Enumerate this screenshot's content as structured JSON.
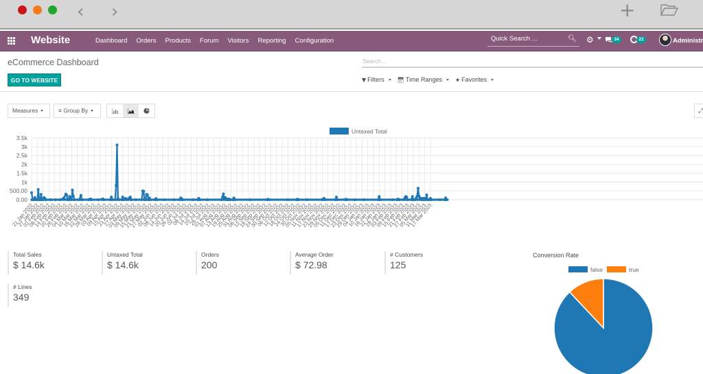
{
  "browser": {
    "back_glyph": "‹",
    "forward_glyph": "›",
    "new_tab_glyph": "+",
    "icons": [
      "close-dot",
      "minimize-dot",
      "maximize-dot",
      "back-arrow-icon",
      "forward-arrow-icon",
      "plus-icon",
      "folder-icon"
    ]
  },
  "navbar": {
    "app_name": "Website",
    "menu": [
      "Dashboard",
      "Orders",
      "Products",
      "Forum",
      "Visitors",
      "Reporting",
      "Configuration"
    ],
    "quick_search_placeholder": "Quick Search ...",
    "messages_count": "34",
    "activities_count": "22",
    "user_name": "Administrator",
    "colors": {
      "bar": "#875a7b",
      "badge": "#00a09d"
    }
  },
  "control_panel": {
    "title": "eCommerce Dashboard",
    "go_button": "GO TO WEBSITE",
    "search_placeholder": "Search...",
    "filters": [
      "Filters",
      "Time Ranges",
      "Favorites"
    ]
  },
  "toolbar": {
    "measures": "Measures",
    "group_by": "Group By",
    "chart_types": [
      "bar",
      "line",
      "pie"
    ],
    "active_chart_type": "line"
  },
  "kpis": [
    {
      "label": "Total Sales",
      "value": "$ 14.6k"
    },
    {
      "label": "Untaxed Total",
      "value": "$ 14.6k"
    },
    {
      "label": "Orders",
      "value": "200"
    },
    {
      "label": "Average Order",
      "value": "$ 72.98"
    },
    {
      "label": "# Customers",
      "value": "125"
    },
    {
      "label": "# Lines",
      "value": "349"
    }
  ],
  "chart_data": [
    {
      "type": "line",
      "title": "",
      "legend": [
        "Untaxed Total"
      ],
      "legend_position": "top-center",
      "xlabel": "",
      "ylabel": "",
      "ylim": [
        0,
        3500
      ],
      "yticks": [
        "0.00",
        "500.00",
        "1k",
        "1.5k",
        "2k",
        "2.5k",
        "3k",
        "3.5k"
      ],
      "ytick_values": [
        0,
        500,
        1000,
        1500,
        2000,
        2500,
        3000,
        3500
      ],
      "grid": true,
      "color": "#1f77b4",
      "categories": [
        "21 Jan 2022",
        "27 Jan 2022",
        "02 Feb 2022",
        "08 Feb 2022",
        "14 Feb 2022",
        "20 Feb 2022",
        "26 Feb 2022",
        "04 Mar 2022",
        "10 Mar 2022",
        "16 Mar 2022",
        "22 Mar 2022",
        "28 Mar 2022",
        "03 Apr 2022",
        "09 Apr 2022",
        "15 Apr 2022",
        "21 Apr 2022",
        "27 Apr 2022",
        "03 May 2022",
        "09 May 2022",
        "15 May 2022",
        "21 May 2022",
        "27 May 2022",
        "02 Jun 2022",
        "08 Jun 2022",
        "14 Jun 2022",
        "20 Jun 2022",
        "26 Jun 2022",
        "02 Jul 2022",
        "08 Jul 2022",
        "14 Jul 2022",
        "20 Jul 2022",
        "26 Jul 2022",
        "01 Aug 2022",
        "07 Aug 2022",
        "13 Aug 2022",
        "19 Aug 2022",
        "25 Aug 2022",
        "31 Aug 2022",
        "06 Sep 2022",
        "12 Sep 2022",
        "18 Sep 2022",
        "24 Sep 2022",
        "30 Sep 2022",
        "06 Oct 2022",
        "12 Oct 2022",
        "18 Oct 2022",
        "24 Oct 2022",
        "30 Oct 2022",
        "05 Nov 2022",
        "11 Nov 2022",
        "17 Nov 2022",
        "23 Nov 2022",
        "29 Nov 2022",
        "05 Dec 2022",
        "11 Dec 2022",
        "17 Dec 2022",
        "23 Dec 2022",
        "29 Dec 2022",
        "04 Jan 2023",
        "10 Jan 2023",
        "16 Jan 2023",
        "22 Jan 2023",
        "28 Jan 2023",
        "03 Feb 2023",
        "09 Feb 2023",
        "15 Feb 2023",
        "21 Feb 2023",
        "27 Feb 2023",
        "05 Mar 2023",
        "11 Mar 2023",
        "17 Mar 2023"
      ],
      "series": [
        {
          "name": "Untaxed Total",
          "points": [
            [
              0,
              400
            ],
            [
              1.2,
              0
            ],
            [
              2.5,
              0
            ],
            [
              3.5,
              120
            ],
            [
              4.5,
              0
            ],
            [
              6,
              0
            ],
            [
              7,
              580
            ],
            [
              8,
              0
            ],
            [
              9,
              0
            ],
            [
              10,
              300
            ],
            [
              11,
              0
            ],
            [
              12,
              0
            ],
            [
              13,
              120
            ],
            [
              14,
              80
            ],
            [
              15,
              0
            ],
            [
              20,
              0
            ],
            [
              25,
              0
            ],
            [
              30,
              0
            ],
            [
              34,
              100
            ],
            [
              36,
              320
            ],
            [
              37,
              260
            ],
            [
              38,
              0
            ],
            [
              39,
              0
            ],
            [
              40,
              180
            ],
            [
              41,
              100
            ],
            [
              42,
              0
            ],
            [
              43,
              550
            ],
            [
              44,
              200
            ],
            [
              45,
              0
            ],
            [
              50,
              0
            ],
            [
              52,
              250
            ],
            [
              53,
              0
            ],
            [
              60,
              0
            ],
            [
              62,
              50
            ],
            [
              63,
              0
            ],
            [
              70,
              0
            ],
            [
              75,
              50
            ],
            [
              76,
              0
            ],
            [
              83,
              0
            ],
            [
              84,
              150
            ],
            [
              85,
              0
            ],
            [
              88,
              0
            ],
            [
              89,
              800
            ],
            [
              90,
              3100
            ],
            [
              91,
              50
            ],
            [
              92,
              0
            ],
            [
              95,
              0
            ],
            [
              96,
              150
            ],
            [
              97,
              0
            ],
            [
              99,
              80
            ],
            [
              100,
              0
            ],
            [
              102,
              50
            ],
            [
              103,
              100
            ],
            [
              104,
              150
            ],
            [
              105,
              0
            ],
            [
              110,
              0
            ],
            [
              116,
              0
            ],
            [
              117,
              500
            ],
            [
              118,
              480
            ],
            [
              119,
              0
            ],
            [
              120,
              0
            ],
            [
              121,
              300
            ],
            [
              122,
              280
            ],
            [
              123,
              0
            ],
            [
              124,
              100
            ],
            [
              125,
              0
            ],
            [
              130,
              0
            ],
            [
              131,
              70
            ],
            [
              132,
              0
            ],
            [
              140,
              0
            ],
            [
              150,
              0
            ],
            [
              156,
              0
            ],
            [
              157,
              100
            ],
            [
              158,
              50
            ],
            [
              159,
              0
            ],
            [
              170,
              0
            ],
            [
              175,
              0
            ],
            [
              176,
              80
            ],
            [
              177,
              0
            ],
            [
              185,
              0
            ],
            [
              200,
              0
            ],
            [
              201,
              150
            ],
            [
              202,
              330
            ],
            [
              203,
              50
            ],
            [
              204,
              120
            ],
            [
              205,
              0
            ],
            [
              206,
              40
            ],
            [
              207,
              0
            ],
            [
              208,
              40
            ],
            [
              209,
              0
            ],
            [
              212,
              0
            ],
            [
              213,
              100
            ],
            [
              214,
              0
            ],
            [
              230,
              0
            ],
            [
              248,
              0
            ],
            [
              249,
              30
            ],
            [
              250,
              0
            ],
            [
              270,
              0
            ],
            [
              279,
              0
            ],
            [
              280,
              30
            ],
            [
              281,
              0
            ],
            [
              290,
              0
            ],
            [
              306,
              0
            ],
            [
              307,
              40
            ],
            [
              308,
              80
            ],
            [
              309,
              0
            ],
            [
              320,
              0
            ],
            [
              321,
              150
            ],
            [
              322,
              0
            ],
            [
              330,
              0
            ],
            [
              331,
              30
            ],
            [
              332,
              0
            ],
            [
              340,
              0
            ],
            [
              350,
              0
            ],
            [
              365,
              0
            ],
            [
              366,
              180
            ],
            [
              367,
              0
            ],
            [
              380,
              0
            ],
            [
              385,
              0
            ],
            [
              386,
              40
            ],
            [
              387,
              0
            ],
            [
              392,
              0
            ],
            [
              393,
              100
            ],
            [
              394,
              180
            ],
            [
              395,
              150
            ],
            [
              396,
              0
            ],
            [
              400,
              0
            ],
            [
              401,
              180
            ],
            [
              402,
              0
            ],
            [
              404,
              0
            ],
            [
              405,
              100
            ],
            [
              406,
              200
            ],
            [
              407,
              650
            ],
            [
              408,
              200
            ],
            [
              409,
              100
            ],
            [
              410,
              60
            ],
            [
              411,
              0
            ],
            [
              412,
              80
            ],
            [
              413,
              0
            ],
            [
              414,
              80
            ],
            [
              415,
              0
            ],
            [
              416,
              270
            ],
            [
              417,
              0
            ],
            [
              419,
              0
            ],
            [
              420,
              80
            ],
            [
              421,
              0
            ],
            [
              430,
              0
            ],
            [
              435,
              0
            ],
            [
              436,
              100
            ],
            [
              437,
              0
            ],
            [
              450,
              0
            ],
            [
              456,
              0
            ],
            [
              457,
              100
            ],
            [
              458,
              0
            ],
            [
              470,
              0
            ],
            [
              480,
              0
            ]
          ]
        }
      ]
    },
    {
      "type": "pie",
      "title": "Conversion Rate",
      "legend": [
        "false",
        "true"
      ],
      "legend_position": "top",
      "slices": [
        {
          "label": "false",
          "value": 88,
          "color": "#1f77b4"
        },
        {
          "label": "true",
          "value": 12,
          "color": "#ff7f0e"
        }
      ]
    }
  ]
}
